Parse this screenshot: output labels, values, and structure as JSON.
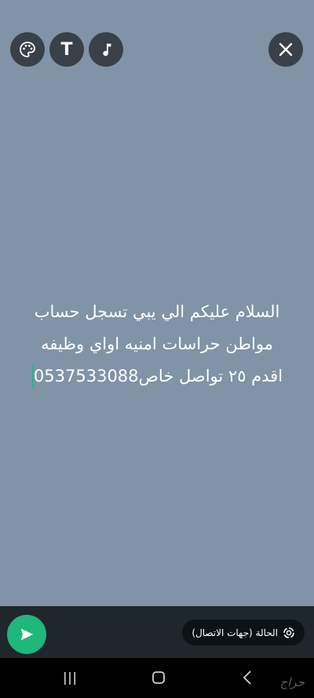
{
  "toolbar": {
    "palette_icon": "palette-icon",
    "text_icon": "text-icon",
    "text_glyph": "T",
    "music_icon": "music-note-icon",
    "close_icon": "close-icon"
  },
  "status": {
    "lines": [
      "السلام عليكم الي يبي تسجل حساب",
      "مواطن حراسات امنيه اواي وظيفه",
      "اقدم ٢٥ تواصل خاص0537533088"
    ],
    "text_color": "#ffffff",
    "background_color": "#8093a7"
  },
  "bottom_bar": {
    "audience_label": "الحالة (جهات الاتصال)",
    "send_icon": "send-arrow-icon",
    "accent": "#1fb77a"
  },
  "nav": {
    "watermark": "حراج"
  }
}
